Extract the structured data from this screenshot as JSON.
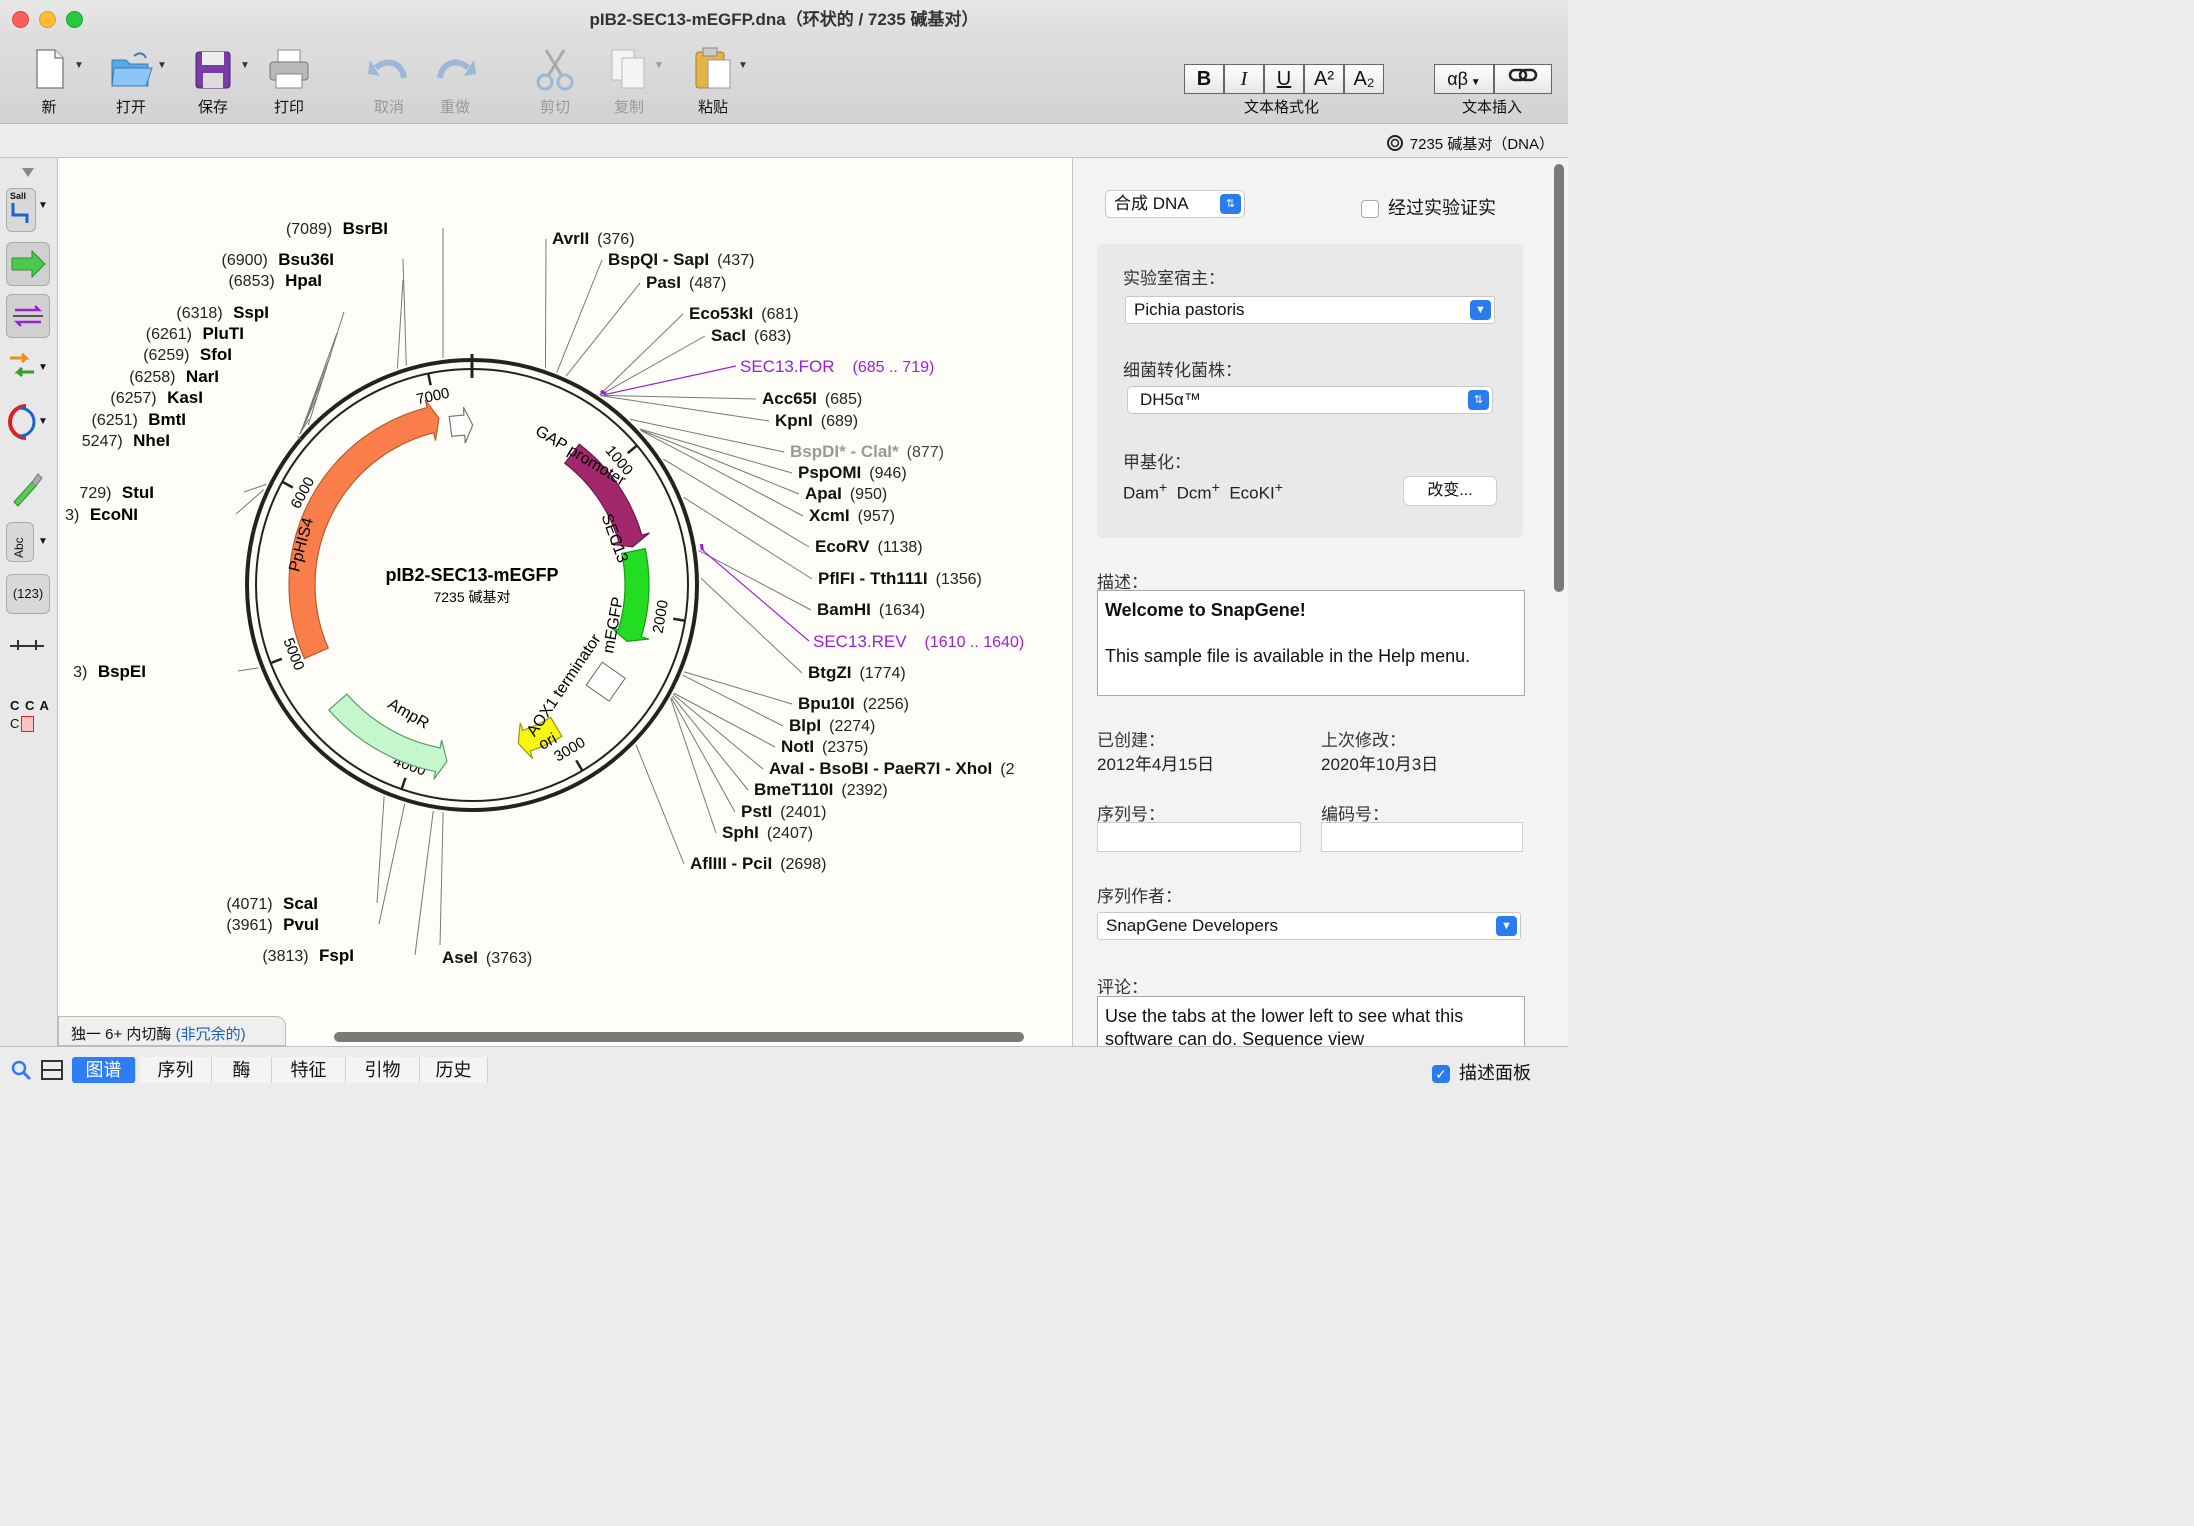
{
  "window": {
    "title": "pIB2-SEC13-mEGFP.dna（环状的 / 7235 碱基对）"
  },
  "toolbar": {
    "buttons": [
      "新",
      "打开",
      "保存",
      "打印",
      "取消",
      "重做",
      "剪切",
      "复制",
      "粘贴"
    ],
    "text_format_label": "文本格式化",
    "text_insert_label": "文本插入",
    "format_buttons": [
      "B",
      "I",
      "U",
      "A²",
      "A₂"
    ],
    "insert_button": "αβ"
  },
  "infobar": {
    "seq_info": "7235 碱基对（DNA）"
  },
  "left_tools": {
    "cca_top": "C C A",
    "cca_bottom": "C   A",
    "abc": "Abc",
    "numbers": "(123)",
    "salI": "SalI"
  },
  "map": {
    "name": "pIB2-SEC13-mEGFP",
    "length_label": "7235 碱基对",
    "ticks": [
      "1000",
      "2000",
      "3000",
      "4000",
      "5000",
      "6000",
      "7000"
    ],
    "features": [
      "GAP promoter",
      "SEC13",
      "mEGFP",
      "AOX1 terminator",
      "ori",
      "AmpR",
      "PpHIS4"
    ],
    "sites_right": [
      {
        "name": "AvrII",
        "pos": "(376)"
      },
      {
        "name": "BspQI - SapI",
        "pos": "(437)"
      },
      {
        "name": "PasI",
        "pos": "(487)"
      },
      {
        "name": "Eco53kI",
        "pos": "(681)"
      },
      {
        "name": "SacI",
        "pos": "(683)"
      },
      {
        "name": "Acc65I",
        "pos": "(685)"
      },
      {
        "name": "KpnI",
        "pos": "(689)"
      },
      {
        "name": "BspDI* - ClaI*",
        "pos": "(877)"
      },
      {
        "name": "PspOMI",
        "pos": "(946)"
      },
      {
        "name": "ApaI",
        "pos": "(950)"
      },
      {
        "name": "XcmI",
        "pos": "(957)"
      },
      {
        "name": "EcoRV",
        "pos": "(1138)"
      },
      {
        "name": "PflFI - Tth111I",
        "pos": "(1356)"
      },
      {
        "name": "BamHI",
        "pos": "(1634)"
      },
      {
        "name": "BtgZI",
        "pos": "(1774)"
      },
      {
        "name": "Bpu10I",
        "pos": "(2256)"
      },
      {
        "name": "BlpI",
        "pos": "(2274)"
      },
      {
        "name": "NotI",
        "pos": "(2375)"
      },
      {
        "name": "AvaI - BsoBI - PaeR7I - XhoI",
        "pos": "(2"
      },
      {
        "name": "BmeT110I",
        "pos": "(2392)"
      },
      {
        "name": "PstI",
        "pos": "(2401)"
      },
      {
        "name": "SphI",
        "pos": "(2407)"
      },
      {
        "name": "AflIII - PciI",
        "pos": "(2698)"
      },
      {
        "name": "AseI",
        "pos": "(3763)"
      }
    ],
    "sites_left": [
      {
        "name": "BsrBI",
        "pos": "(7089)"
      },
      {
        "name": "Bsu36I",
        "pos": "(6900)"
      },
      {
        "name": "HpaI",
        "pos": "(6853)"
      },
      {
        "name": "SspI",
        "pos": "(6318)"
      },
      {
        "name": "PluTI",
        "pos": "(6261)"
      },
      {
        "name": "SfoI",
        "pos": "(6259)"
      },
      {
        "name": "NarI",
        "pos": "(6258)"
      },
      {
        "name": "KasI",
        "pos": "(6257)"
      },
      {
        "name": "BmtI",
        "pos": "(6251)"
      },
      {
        "name": "NheI",
        "pos": "5247)"
      },
      {
        "name": "StuI",
        "pos": "729)"
      },
      {
        "name": "EcoNI",
        "pos": "3)"
      },
      {
        "name": "BspEI",
        "pos": "3)"
      },
      {
        "name": "ScaI",
        "pos": "(4071)"
      },
      {
        "name": "PvuI",
        "pos": "(3961)"
      },
      {
        "name": "FspI",
        "pos": "(3813)"
      }
    ],
    "primers": [
      {
        "name": "SEC13.FOR",
        "range": "(685 .. 719)"
      },
      {
        "name": "SEC13.REV",
        "range": "(1610 .. 1640)"
      }
    ],
    "enzyme_tab": {
      "label": "独一 6+ 内切酶",
      "mode": "(非冗余的)"
    }
  },
  "panel": {
    "seq_type": "合成 DNA",
    "verified_label": "经过实验证实",
    "host_label": "实验室宿主：",
    "host_value": "Pichia pastoris",
    "strain_label": "细菌转化菌株：",
    "strain_value": "DH5α™",
    "methylation_label": "甲基化：",
    "methylation": [
      "Dam",
      "Dcm",
      "EcoKI"
    ],
    "methylation_sup": "+",
    "change_button": "改变...",
    "desc_label": "描述：",
    "desc_title": "Welcome to SnapGene!",
    "desc_body": "This sample file is available in the Help menu.",
    "created_label": "已创建：",
    "created_value": "2012年4月15日",
    "modified_label": "上次修改：",
    "modified_value": "2020年10月3日",
    "serial_label": "序列号：",
    "code_label": "编码号：",
    "author_label": "序列作者：",
    "author_value": "SnapGene Developers",
    "comment_label": "评论：",
    "comment_text": "Use the tabs at the lower left to see what this software can do. Sequence view"
  },
  "bottom": {
    "tabs": [
      "图谱",
      "序列",
      "酶",
      "特征",
      "引物",
      "历史"
    ],
    "desc_panel_label": "描述面板"
  },
  "colors": {
    "accent": "#2e7df5",
    "primer": "#9b1fd6",
    "PpHIS4": "#f97e4a",
    "SEC13": "#a3276d",
    "mEGFP": "#22dd22",
    "ori": "#f7f712",
    "AmpR": "#c5f7cd"
  }
}
